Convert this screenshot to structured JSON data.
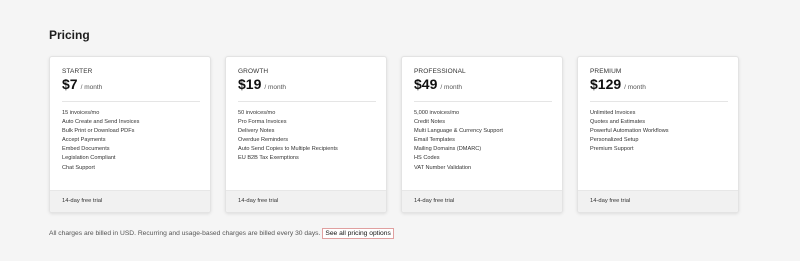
{
  "section_title": "Pricing",
  "plans": [
    {
      "name": "STARTER",
      "price": "$7",
      "period": "/ month",
      "features": [
        "15 invoices/mo",
        "Auto Create and Send Invoices",
        "Bulk Print or Download PDFs",
        "Accept Payments",
        "Embed Documents",
        "Legislation Compliant",
        "Chat Support"
      ],
      "trial": "14-day free trial"
    },
    {
      "name": "GROWTH",
      "price": "$19",
      "period": "/ month",
      "features": [
        "50 invoices/mo",
        "Pro Forma Invoices",
        "Delivery Notes",
        "Overdue Reminders",
        "Auto Send Copies to Multiple Recipients",
        "EU B2B Tax Exemptions"
      ],
      "trial": "14-day free trial"
    },
    {
      "name": "PROFESSIONAL",
      "price": "$49",
      "period": "/ month",
      "features": [
        "5,000 invoices/mo",
        "Credit Notes",
        "Multi Language & Currency Support",
        "Email Templates",
        "Mailing Domains (DMARC)",
        "HS Codes",
        "VAT Number Validation"
      ],
      "trial": "14-day free trial"
    },
    {
      "name": "PREMIUM",
      "price": "$129",
      "period": "/ month",
      "features": [
        "Unlimited Invoices",
        "Quotes and Estimates",
        "Powerful Automation Workflows",
        "Personalized Setup",
        "Premium Support"
      ],
      "trial": "14-day free trial"
    }
  ],
  "footer_note": {
    "text": "All charges are billed in USD. Recurring and usage-based charges are billed every 30 days.",
    "link_label": "See all pricing options"
  }
}
